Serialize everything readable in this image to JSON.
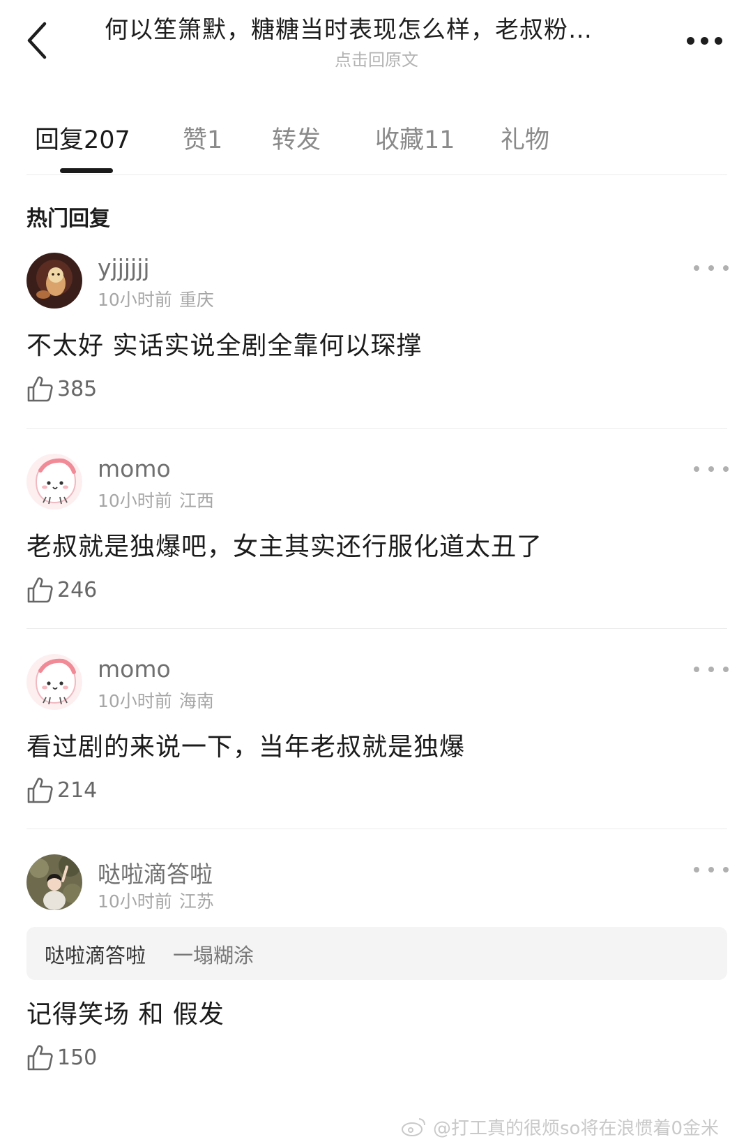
{
  "header": {
    "title": "何以笙箫默，糖糖当时表现怎么样，老叔粉…",
    "subtitle": "点击回原文"
  },
  "tabs": [
    {
      "label": "回复",
      "count": "207"
    },
    {
      "label": "赞",
      "count": "1"
    },
    {
      "label": "转发",
      "count": ""
    },
    {
      "label": "收藏",
      "count": "11"
    },
    {
      "label": "礼物",
      "count": ""
    }
  ],
  "section_title": "热门回复",
  "comments": [
    {
      "username": "yjjjjjj",
      "time": "10小时前",
      "location": "重庆",
      "text": "不太好 实话实说全剧全靠何以琛撑",
      "likes": "385",
      "avatar": "dog-avatar"
    },
    {
      "username": "momo",
      "time": "10小时前",
      "location": "江西",
      "text": "老叔就是独爆吧，女主其实还行服化道太丑了",
      "likes": "246",
      "avatar": "cartoon-avatar"
    },
    {
      "username": "momo",
      "time": "10小时前",
      "location": "海南",
      "text": "看过剧的来说一下，当年老叔就是独爆",
      "likes": "214",
      "avatar": "cartoon-avatar"
    },
    {
      "username": "哒啦滴答啦",
      "time": "10小时前",
      "location": "江苏",
      "quote_user": "哒啦滴答啦",
      "quote_text": "一塌糊涂",
      "text": "记得笑场 和 假发",
      "likes": "150",
      "avatar": "photo-avatar"
    }
  ],
  "watermark": "@打工真的很烦so将在浪惯着0金米",
  "colors": {
    "text": "#1b1b1b",
    "secondary": "#a6a6a6",
    "divider": "#ececec",
    "quote_bg": "#f4f4f4"
  }
}
